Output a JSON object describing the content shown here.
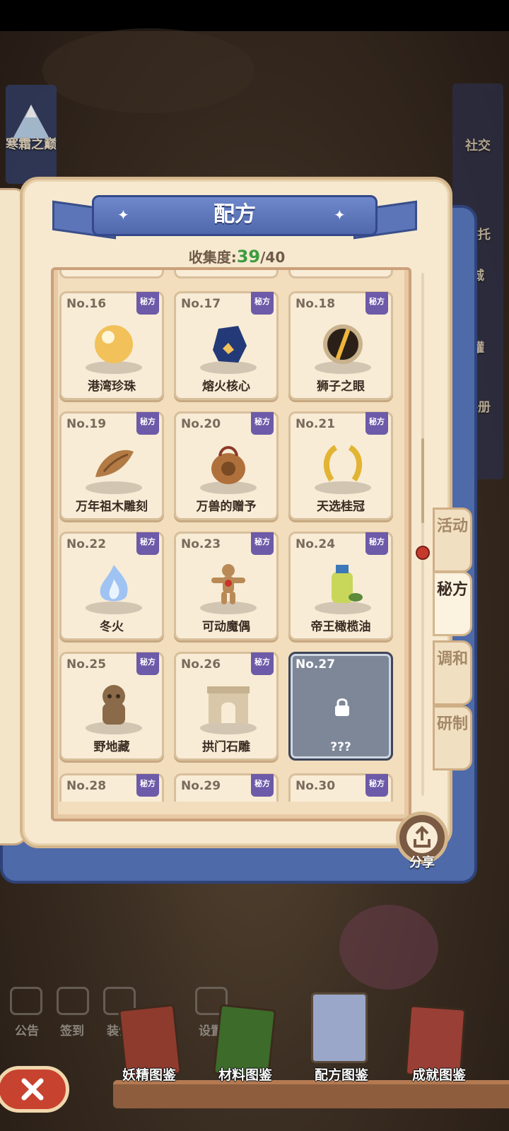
{
  "hud": {
    "left_banner": "寒霜之巅",
    "right_banner": [
      "社交",
      "委托",
      "城",
      "罐",
      "手册"
    ]
  },
  "panel": {
    "title": "配方",
    "collect_label": "收集度:",
    "collect_count": "39",
    "collect_total": "/40"
  },
  "recipes": [
    {
      "no": "No.16",
      "name": "港湾珍珠",
      "badge": "秘方",
      "icon": "pearl-icon"
    },
    {
      "no": "No.17",
      "name": "熔火核心",
      "badge": "秘方",
      "icon": "lava-core-icon"
    },
    {
      "no": "No.18",
      "name": "狮子之眼",
      "badge": "秘方",
      "icon": "lion-eye-icon"
    },
    {
      "no": "No.19",
      "name": "万年祖木雕刻",
      "badge": "秘方",
      "icon": "wood-carving-icon"
    },
    {
      "no": "No.20",
      "name": "万兽的赠予",
      "badge": "秘方",
      "icon": "beast-gift-icon"
    },
    {
      "no": "No.21",
      "name": "天选桂冠",
      "badge": "秘方",
      "icon": "laurel-icon"
    },
    {
      "no": "No.22",
      "name": "冬火",
      "badge": "秘方",
      "icon": "winter-fire-icon"
    },
    {
      "no": "No.23",
      "name": "可动魔偶",
      "badge": "秘方",
      "icon": "voodoo-doll-icon"
    },
    {
      "no": "No.24",
      "name": "帝王橄榄油",
      "badge": "秘方",
      "icon": "olive-oil-icon"
    },
    {
      "no": "No.25",
      "name": "野地藏",
      "badge": "秘方",
      "icon": "idol-icon"
    },
    {
      "no": "No.26",
      "name": "拱门石雕",
      "badge": "秘方",
      "icon": "arch-icon"
    },
    {
      "no": "No.27",
      "name": "???",
      "badge": "",
      "icon": "lock-icon",
      "locked": true
    }
  ],
  "partial_recipes": [
    {
      "no": "No.28",
      "badge": "秘方"
    },
    {
      "no": "No.29",
      "badge": "秘方"
    },
    {
      "no": "No.30",
      "badge": "秘方"
    }
  ],
  "tabs": [
    {
      "label": "活动",
      "active": false
    },
    {
      "label": "秘方",
      "active": true
    },
    {
      "label": "调和",
      "active": false
    },
    {
      "label": "研制",
      "active": false
    }
  ],
  "share_label": "分享",
  "bottom_icons": [
    "公告",
    "签到",
    "装饰",
    "设置"
  ],
  "books": [
    {
      "label": "妖精图鉴",
      "color": "#8e3b2d"
    },
    {
      "label": "材料图鉴",
      "color": "#3d6b2a"
    },
    {
      "label": "配方图鉴",
      "color": "#9aa7c8"
    },
    {
      "label": "成就图鉴",
      "color": "#9a3f35"
    }
  ],
  "colors": {
    "ribbon": "#5c74b8",
    "badge": "#6d5aa8",
    "collect_count": "#3d9c42",
    "locked_card": "#7d8798"
  }
}
